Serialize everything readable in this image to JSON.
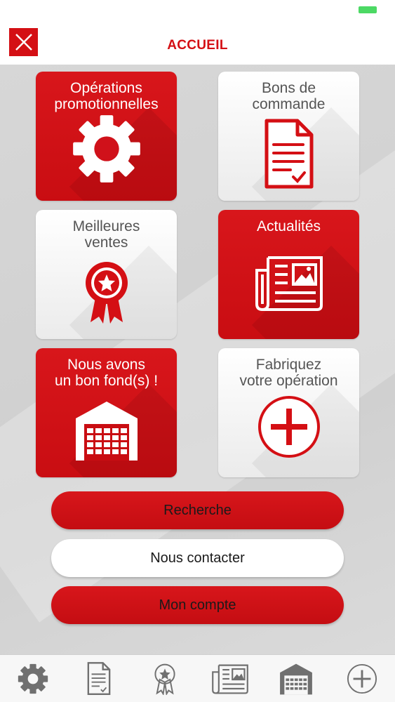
{
  "header": {
    "title": "ACCUEIL"
  },
  "tiles": [
    {
      "label": "Opérations\npromotionnelles",
      "icon": "gear-icon",
      "style": "red"
    },
    {
      "label": "Bons de\ncommande",
      "icon": "document-icon",
      "style": "white"
    },
    {
      "label": "Meilleures\nventes",
      "icon": "ribbon-star-icon",
      "style": "white"
    },
    {
      "label": "Actualités",
      "icon": "newspaper-icon",
      "style": "red"
    },
    {
      "label": "Nous avons\nun bon fond(s) !",
      "icon": "warehouse-icon",
      "style": "red"
    },
    {
      "label": "Fabriquez\nvotre opération",
      "icon": "plus-circle-icon",
      "style": "white"
    }
  ],
  "buttons": {
    "search": "Recherche",
    "contact": "Nous contacter",
    "account": "Mon compte"
  },
  "tabbar": {
    "items": [
      "gear-icon",
      "document-icon",
      "ribbon-star-icon",
      "newspaper-icon",
      "warehouse-icon",
      "plus-circle-icon"
    ]
  },
  "colors": {
    "brand_red": "#d40f14",
    "tab_icon_gray": "#707070"
  }
}
